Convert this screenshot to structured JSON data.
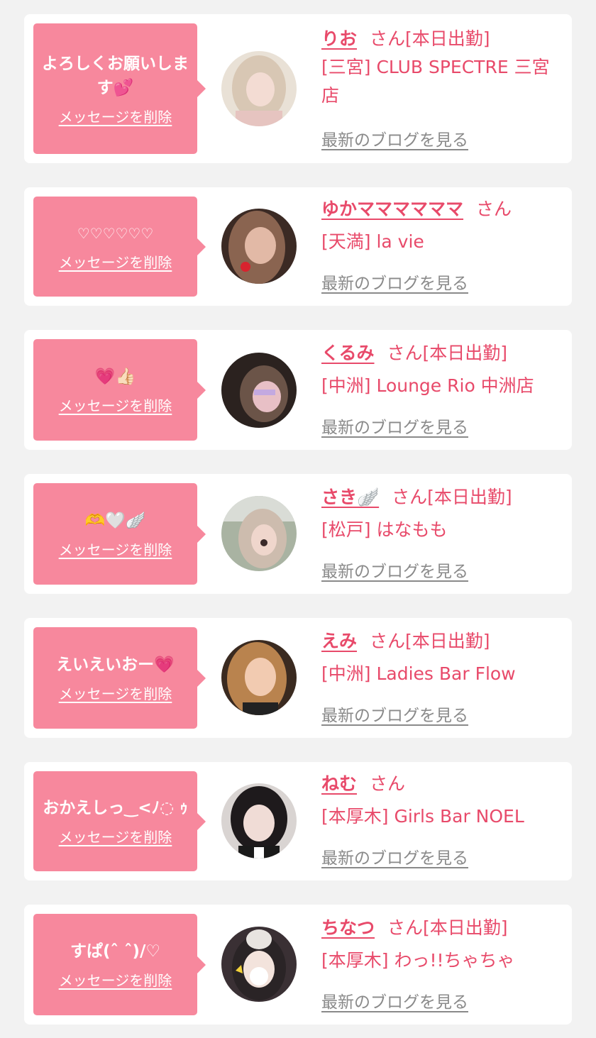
{
  "cards": [
    {
      "message": "よろしくお願いします💕",
      "delete_label": "メッセージを削除",
      "name": "りお",
      "honorific": "さん",
      "status": "[本日出勤]",
      "shop": "[三宮] CLUB SPECTRE 三宮店",
      "blog_label": "最新のブログを見る",
      "avatar_colors": [
        "#e9e1d6",
        "#c9b8a6",
        "#f1d7cf"
      ]
    },
    {
      "message": "♡♡♡♡♡♡",
      "delete_label": "メッセージを削除",
      "name": "ゆかママママママ",
      "honorific": "さん",
      "status": "",
      "shop": "[天満] la vie",
      "blog_label": "最新のブログを見る",
      "avatar_colors": [
        "#3b2a24",
        "#a87c64",
        "#d9a89a"
      ]
    },
    {
      "message": "💗👍🏻",
      "delete_label": "メッセージを削除",
      "name": "くるみ",
      "honorific": "さん",
      "status": "[本日出勤]",
      "shop": "[中洲] Lounge Rio 中洲店",
      "blog_label": "最新のブログを見る",
      "avatar_colors": [
        "#2b221f",
        "#7a6258",
        "#e3b7bd"
      ]
    },
    {
      "message": "🫶🤍🪽",
      "delete_label": "メッセージを削除",
      "name": "さき🪽",
      "honorific": "さん",
      "status": "[本日出勤]",
      "shop": "[松戸] はなもも",
      "blog_label": "最新のブログを見る",
      "avatar_colors": [
        "#aeb6a4",
        "#d6c8bc",
        "#8a9a7c"
      ]
    },
    {
      "message": "えいえいおー💗",
      "delete_label": "メッセージを削除",
      "name": "えみ",
      "honorific": "さん",
      "status": "[本日出勤]",
      "shop": "[中洲] Ladies Bar Flow",
      "blog_label": "最新のブログを見る",
      "avatar_colors": [
        "#3a2a20",
        "#c8955f",
        "#f0c8a8"
      ]
    },
    {
      "message": "おかえしっ‿<ﾉ◌ ｩ",
      "delete_label": "メッセージを削除",
      "name": "ねむ",
      "honorific": "さん",
      "status": "",
      "shop": "[本厚木] Girls Bar NOEL",
      "blog_label": "最新のブログを見る",
      "avatar_colors": [
        "#1e1a1c",
        "#c9a9a5",
        "#ece2dc"
      ]
    },
    {
      "message": "すぱ(ˆ ˆ)/♡",
      "delete_label": "メッセージを削除",
      "name": "ちなつ",
      "honorific": "さん",
      "status": "[本日出勤]",
      "shop": "[本厚木] わっ!!ちゃちゃ",
      "blog_label": "最新のブログを見る",
      "avatar_colors": [
        "#2a2426",
        "#e8e4e0",
        "#f3d23a"
      ]
    }
  ],
  "colors": {
    "accent": "#e84a6a",
    "bubble": "#f7889d",
    "link_gray": "#8a8a8a",
    "background": "#f2f2f2"
  }
}
